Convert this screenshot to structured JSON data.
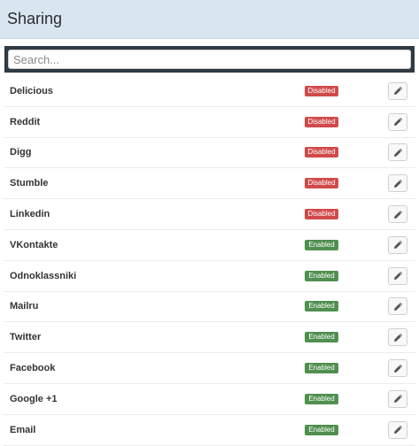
{
  "header": {
    "title": "Sharing"
  },
  "search": {
    "placeholder": "Search...",
    "value": ""
  },
  "colors": {
    "header_bg": "#d9e6f2",
    "disabled": "#d14a4a",
    "enabled": "#4f8f4f"
  },
  "items": [
    {
      "name": "Delicious",
      "status": "Disabled"
    },
    {
      "name": "Reddit",
      "status": "Disabled"
    },
    {
      "name": "Digg",
      "status": "Disabled"
    },
    {
      "name": "Stumble",
      "status": "Disabled"
    },
    {
      "name": "Linkedin",
      "status": "Disabled"
    },
    {
      "name": "VKontakte",
      "status": "Enabled"
    },
    {
      "name": "Odnoklassniki",
      "status": "Enabled"
    },
    {
      "name": "Mailru",
      "status": "Enabled"
    },
    {
      "name": "Twitter",
      "status": "Enabled"
    },
    {
      "name": "Facebook",
      "status": "Enabled"
    },
    {
      "name": "Google +1",
      "status": "Enabled"
    },
    {
      "name": "Email",
      "status": "Enabled"
    }
  ],
  "icons": {
    "edit": "pencil-icon"
  }
}
